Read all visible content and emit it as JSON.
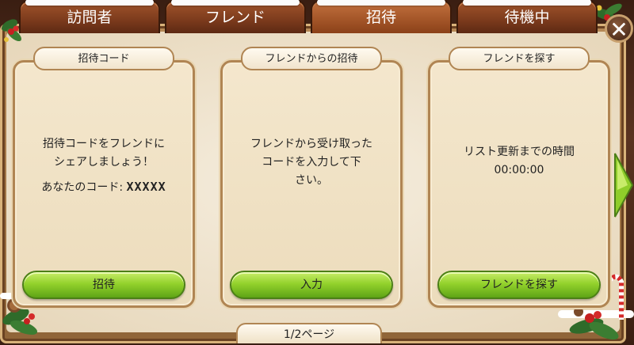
{
  "tabs": [
    {
      "label": "訪問者"
    },
    {
      "label": "フレンド"
    },
    {
      "label": "招待"
    },
    {
      "label": "待機中"
    }
  ],
  "active_tab_index": 2,
  "close_label": "✕",
  "panels": {
    "invite_code": {
      "header": "招待コード",
      "message_line1": "招待コードをフレンドに",
      "message_line2": "シェアしましょう！",
      "code_label": "あなたのコード:",
      "code_value": "XXXXX",
      "button": "招待"
    },
    "from_friend": {
      "header": "フレンドからの招待",
      "message_line1": "フレンドから受け取った",
      "message_line2": "コードを入力して下",
      "message_line3": "さい。",
      "button": "入力"
    },
    "find_friend": {
      "header": "フレンドを探す",
      "message_line1": "リスト更新までの時間",
      "timer": "00:00:00",
      "button": "フレンドを探す"
    }
  },
  "pager": "1/2ページ",
  "colors": {
    "tab_bg": "#7b3a1c",
    "tab_active_bg": "#a25427",
    "button_green": "#93d22c",
    "panel_bg": "#f4e7cd",
    "panel_border": "#b08553"
  }
}
